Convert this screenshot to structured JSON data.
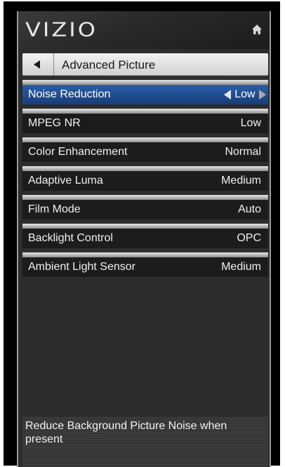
{
  "brand": "VIZIO",
  "header": {
    "home_icon": "home-icon"
  },
  "nav": {
    "back_icon": "triangle-left-icon",
    "title": "Advanced Picture"
  },
  "settings": [
    {
      "label": "Noise Reduction",
      "value": "Low",
      "selected": true
    },
    {
      "label": "MPEG NR",
      "value": "Low",
      "selected": false
    },
    {
      "label": "Color Enhancement",
      "value": "Normal",
      "selected": false
    },
    {
      "label": "Adaptive Luma",
      "value": "Medium",
      "selected": false
    },
    {
      "label": "Film Mode",
      "value": "Auto",
      "selected": false
    },
    {
      "label": "Backlight Control",
      "value": "OPC",
      "selected": false
    },
    {
      "label": "Ambient Light Sensor",
      "value": "Medium",
      "selected": false
    }
  ],
  "description": "Reduce Background Picture Noise when present",
  "colors": {
    "selected_row": "#2a5fa8",
    "row_background": "#1c1c1c",
    "panel_background": "#2d2d2d"
  }
}
